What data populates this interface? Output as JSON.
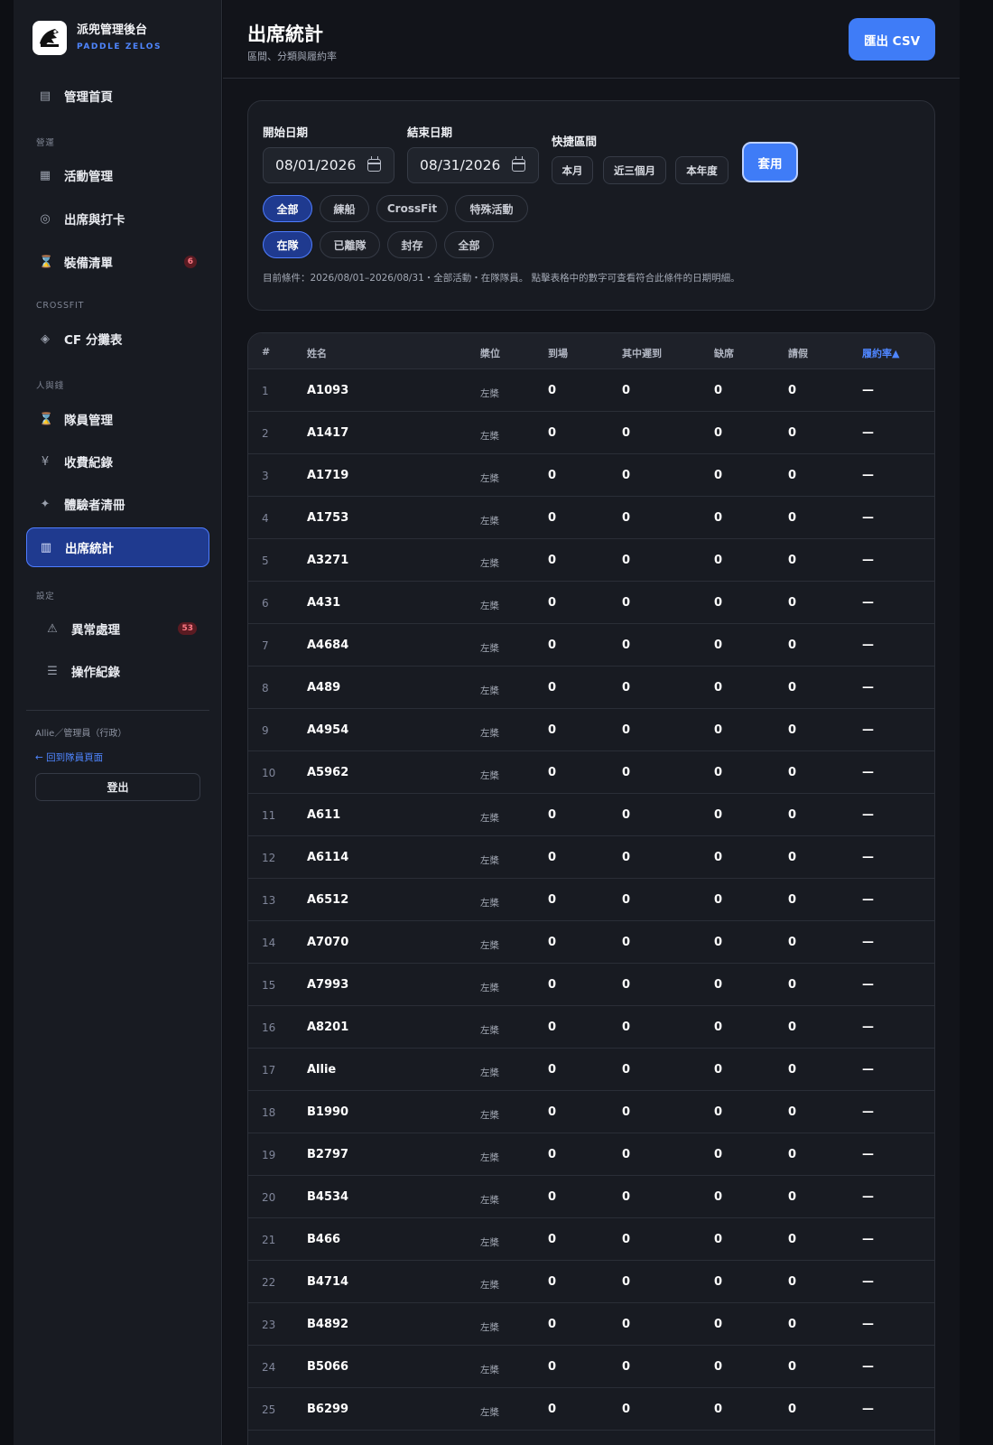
{
  "brand": {
    "title": "派兜管理後台",
    "subtitle": "PADDLE ZELOS"
  },
  "sidebar": {
    "home": "管理首頁",
    "sections": {
      "ops": "營運",
      "crossfit": "CROSSFIT",
      "people": "人與錢",
      "settings": "設定"
    },
    "items": {
      "activities": "活動管理",
      "checkin": "出席與打卡",
      "equipment": "裝備清單",
      "equipment_badge": "6",
      "cf_split": "CF 分攤表",
      "members": "隊員管理",
      "payments": "收費紀錄",
      "trial": "體驗者清冊",
      "attendance": "出席統計",
      "anomalies": "異常處理",
      "anomalies_badge": "53",
      "logs": "操作紀錄"
    },
    "user": "Allie／管理員（行政）",
    "back_link": "← 回到隊員頁面",
    "logout": "登出"
  },
  "header": {
    "title": "出席統計",
    "subtitle": "區間、分類與履約率",
    "export": "匯出 CSV"
  },
  "filters": {
    "start_label": "開始日期",
    "start_value": "08/01/2026",
    "end_label": "結束日期",
    "end_value": "08/31/2026",
    "quick_label": "快捷區間",
    "quick": [
      "本月",
      "近三個月",
      "本年度"
    ],
    "apply": "套用",
    "categories": [
      "全部",
      "練船",
      "CrossFit",
      "特殊活動"
    ],
    "status": [
      "在隊",
      "已離隊",
      "封存",
      "全部"
    ],
    "condition": "目前條件：2026/08/01–2026/08/31・全部活動・在隊隊員。 點擊表格中的數字可查看符合此條件的日期明細。"
  },
  "table": {
    "headers": {
      "idx": "#",
      "name": "姓名",
      "position": "槳位",
      "attended": "到場",
      "late": "其中遲到",
      "absent": "缺席",
      "leave": "請假",
      "rate": "履約率▲"
    },
    "rows": [
      {
        "idx": "1",
        "name": "A1093",
        "position": "左槳",
        "attended": "0",
        "late": "0",
        "absent": "0",
        "leave": "0",
        "rate": "—"
      },
      {
        "idx": "2",
        "name": "A1417",
        "position": "左槳",
        "attended": "0",
        "late": "0",
        "absent": "0",
        "leave": "0",
        "rate": "—"
      },
      {
        "idx": "3",
        "name": "A1719",
        "position": "左槳",
        "attended": "0",
        "late": "0",
        "absent": "0",
        "leave": "0",
        "rate": "—"
      },
      {
        "idx": "4",
        "name": "A1753",
        "position": "左槳",
        "attended": "0",
        "late": "0",
        "absent": "0",
        "leave": "0",
        "rate": "—"
      },
      {
        "idx": "5",
        "name": "A3271",
        "position": "左槳",
        "attended": "0",
        "late": "0",
        "absent": "0",
        "leave": "0",
        "rate": "—"
      },
      {
        "idx": "6",
        "name": "A431",
        "position": "左槳",
        "attended": "0",
        "late": "0",
        "absent": "0",
        "leave": "0",
        "rate": "—"
      },
      {
        "idx": "7",
        "name": "A4684",
        "position": "左槳",
        "attended": "0",
        "late": "0",
        "absent": "0",
        "leave": "0",
        "rate": "—"
      },
      {
        "idx": "8",
        "name": "A489",
        "position": "左槳",
        "attended": "0",
        "late": "0",
        "absent": "0",
        "leave": "0",
        "rate": "—"
      },
      {
        "idx": "9",
        "name": "A4954",
        "position": "左槳",
        "attended": "0",
        "late": "0",
        "absent": "0",
        "leave": "0",
        "rate": "—"
      },
      {
        "idx": "10",
        "name": "A5962",
        "position": "左槳",
        "attended": "0",
        "late": "0",
        "absent": "0",
        "leave": "0",
        "rate": "—"
      },
      {
        "idx": "11",
        "name": "A611",
        "position": "左槳",
        "attended": "0",
        "late": "0",
        "absent": "0",
        "leave": "0",
        "rate": "—"
      },
      {
        "idx": "12",
        "name": "A6114",
        "position": "左槳",
        "attended": "0",
        "late": "0",
        "absent": "0",
        "leave": "0",
        "rate": "—"
      },
      {
        "idx": "13",
        "name": "A6512",
        "position": "左槳",
        "attended": "0",
        "late": "0",
        "absent": "0",
        "leave": "0",
        "rate": "—"
      },
      {
        "idx": "14",
        "name": "A7070",
        "position": "左槳",
        "attended": "0",
        "late": "0",
        "absent": "0",
        "leave": "0",
        "rate": "—"
      },
      {
        "idx": "15",
        "name": "A7993",
        "position": "左槳",
        "attended": "0",
        "late": "0",
        "absent": "0",
        "leave": "0",
        "rate": "—"
      },
      {
        "idx": "16",
        "name": "A8201",
        "position": "左槳",
        "attended": "0",
        "late": "0",
        "absent": "0",
        "leave": "0",
        "rate": "—"
      },
      {
        "idx": "17",
        "name": "Allie",
        "position": "左槳",
        "attended": "0",
        "late": "0",
        "absent": "0",
        "leave": "0",
        "rate": "—"
      },
      {
        "idx": "18",
        "name": "B1990",
        "position": "左槳",
        "attended": "0",
        "late": "0",
        "absent": "0",
        "leave": "0",
        "rate": "—"
      },
      {
        "idx": "19",
        "name": "B2797",
        "position": "左槳",
        "attended": "0",
        "late": "0",
        "absent": "0",
        "leave": "0",
        "rate": "—"
      },
      {
        "idx": "20",
        "name": "B4534",
        "position": "左槳",
        "attended": "0",
        "late": "0",
        "absent": "0",
        "leave": "0",
        "rate": "—"
      },
      {
        "idx": "21",
        "name": "B466",
        "position": "左槳",
        "attended": "0",
        "late": "0",
        "absent": "0",
        "leave": "0",
        "rate": "—"
      },
      {
        "idx": "22",
        "name": "B4714",
        "position": "左槳",
        "attended": "0",
        "late": "0",
        "absent": "0",
        "leave": "0",
        "rate": "—"
      },
      {
        "idx": "23",
        "name": "B4892",
        "position": "左槳",
        "attended": "0",
        "late": "0",
        "absent": "0",
        "leave": "0",
        "rate": "—"
      },
      {
        "idx": "24",
        "name": "B5066",
        "position": "左槳",
        "attended": "0",
        "late": "0",
        "absent": "0",
        "leave": "0",
        "rate": "—"
      },
      {
        "idx": "25",
        "name": "B6299",
        "position": "左槳",
        "attended": "0",
        "late": "0",
        "absent": "0",
        "leave": "0",
        "rate": "—"
      }
    ]
  }
}
